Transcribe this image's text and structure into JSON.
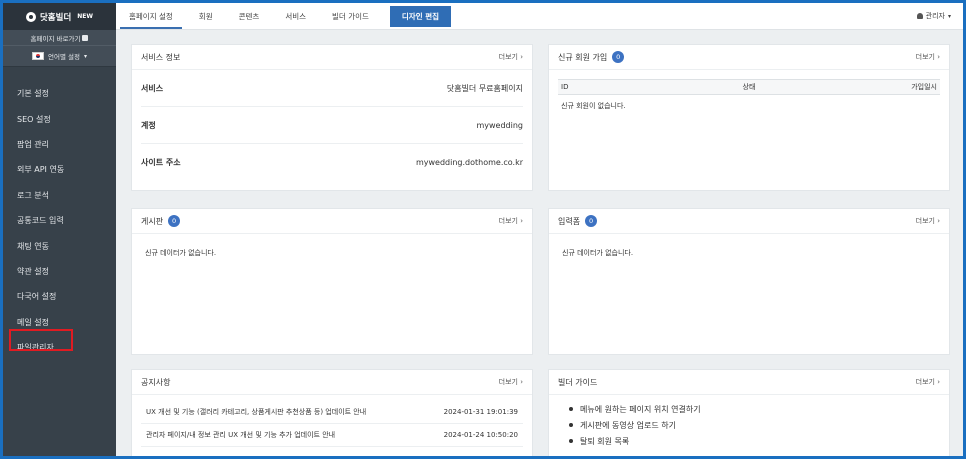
{
  "brand": {
    "name": "닷홈빌더",
    "tag": "NEW"
  },
  "sidebar": {
    "homepage_link": "홈페이지 바로가기",
    "lang_label": "언어별 설정",
    "items": [
      "기본 설정",
      "SEO 설정",
      "팝업 관리",
      "외부 API 연동",
      "로그 분석",
      "공통코드 입력",
      "채팅 연동",
      "약관 설정",
      "다국어 설정",
      "메일 설정",
      "파일관리자"
    ]
  },
  "topnav": {
    "tabs": [
      "홈페이지 설정",
      "회원",
      "콘텐츠",
      "서비스",
      "빌더 가이드"
    ],
    "primary": "디자인 편집",
    "user": "관리자"
  },
  "more": "더보기",
  "service": {
    "title": "서비스 정보",
    "rows": [
      {
        "k": "서비스",
        "v": "닷홈빌더 무료홈페이지"
      },
      {
        "k": "계정",
        "v": "mywedding"
      },
      {
        "k": "사이트 주소",
        "v": "mywedding.dothome.co.kr"
      }
    ]
  },
  "new_members": {
    "title": "신규 회원 가입",
    "count": "0",
    "columns": [
      "ID",
      "상태",
      "가입일시"
    ],
    "empty": "신규 회원이 없습니다."
  },
  "board": {
    "title": "게시판",
    "count": "0",
    "empty": "신규 데이터가 없습니다."
  },
  "form": {
    "title": "입력폼",
    "count": "0",
    "empty": "신규 데이터가 없습니다."
  },
  "notice": {
    "title": "공지사항",
    "rows": [
      {
        "t": "UX 개선 및 기능 (갤러리 카테고리, 상품게시판 추천상품 등) 업데이트 안내",
        "d": "2024-01-31 19:01:39"
      },
      {
        "t": "관리자 페이지/내 정보 관리 UX 개선 및 기능 추가 업데이트 안내",
        "d": "2024-01-24 10:50:20"
      }
    ]
  },
  "guide": {
    "title": "빌더 가이드",
    "items": [
      "메뉴에 원하는 페이지 위치 연결하기",
      "게시판에 동영상 업로드 하기",
      "탈퇴 회원 목록"
    ]
  }
}
